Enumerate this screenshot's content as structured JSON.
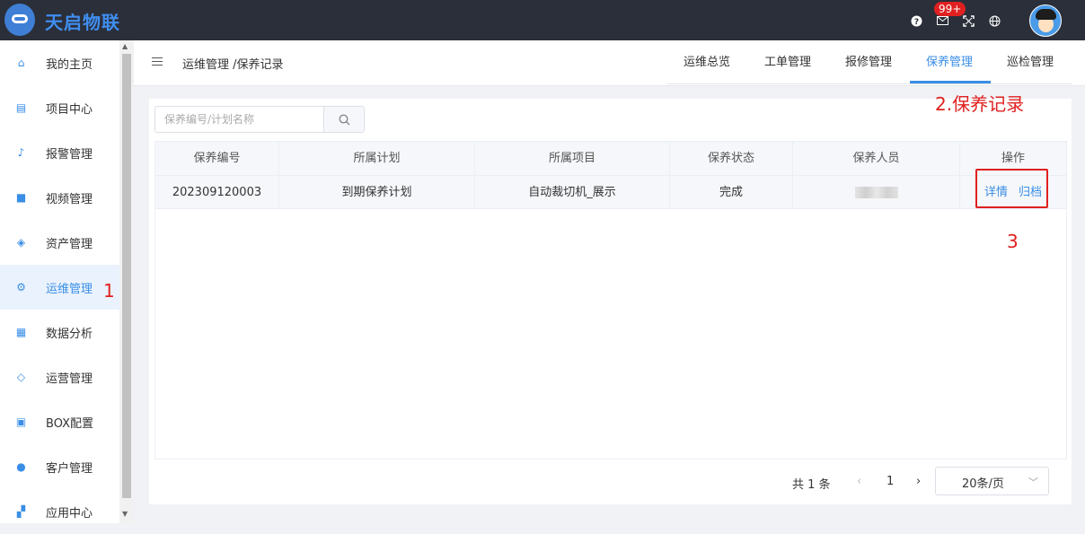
{
  "app": {
    "brand": "天启物联"
  },
  "topbar": {
    "help_icon": "question-circle-icon",
    "mail_icon": "mail-icon",
    "notification_badge": "99+",
    "fullscreen_icon": "fullscreen-icon",
    "language_icon": "globe-icon"
  },
  "sidebar": {
    "items": [
      {
        "label": "我的主页",
        "icon": "home-icon"
      },
      {
        "label": "项目中心",
        "icon": "project-icon"
      },
      {
        "label": "报警管理",
        "icon": "bell-icon"
      },
      {
        "label": "视频管理",
        "icon": "video-icon"
      },
      {
        "label": "资产管理",
        "icon": "asset-icon"
      },
      {
        "label": "运维管理",
        "icon": "gear-icon"
      },
      {
        "label": "数据分析",
        "icon": "monitor-chart-icon"
      },
      {
        "label": "运营管理",
        "icon": "shield-icon"
      },
      {
        "label": "BOX配置",
        "icon": "box-config-icon"
      },
      {
        "label": "客户管理",
        "icon": "users-icon"
      },
      {
        "label": "应用中心",
        "icon": "apps-icon"
      }
    ],
    "active_label": "运维管理"
  },
  "annotations": {
    "step1": "1",
    "step2": "2.保养记录",
    "step3": "3"
  },
  "header": {
    "breadcrumb": "运维管理 /保养记录",
    "tabs": [
      {
        "label": "运维总览"
      },
      {
        "label": "工单管理"
      },
      {
        "label": "报修管理"
      },
      {
        "label": "保养管理"
      },
      {
        "label": "巡检管理"
      }
    ],
    "active_tab": "保养管理"
  },
  "search": {
    "placeholder": "保养编号/计划名称",
    "value": ""
  },
  "table": {
    "columns": [
      "保养编号",
      "所属计划",
      "所属项目",
      "保养状态",
      "保养人员",
      "操作"
    ],
    "rows": [
      {
        "code": "202309120003",
        "plan": "到期保养计划",
        "project": "自动裁切机_展示",
        "status": "完成",
        "person": "",
        "actions": [
          "详情",
          "归档"
        ]
      }
    ]
  },
  "pagination": {
    "total_text": "共 1 条",
    "current_page": "1",
    "page_size": "20条/页"
  },
  "colors": {
    "accent": "#3a8ee6",
    "topbar": "#2b2f3a",
    "annotation": "#e02020"
  }
}
